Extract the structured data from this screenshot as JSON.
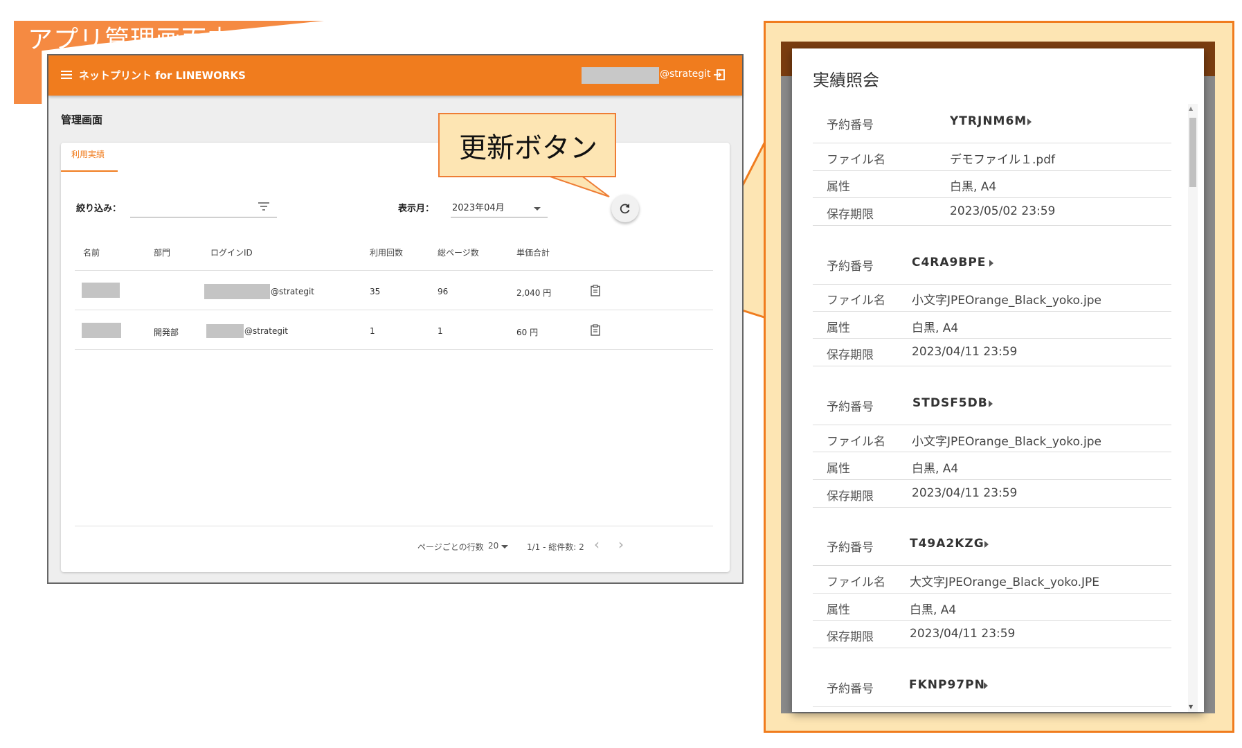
{
  "banner": {
    "title": "アプリ管理画面内"
  },
  "app": {
    "header": {
      "title": "ネットプリント for LINEWORKS",
      "user_domain": "@strategit"
    },
    "page_title": "管理画面",
    "tab": "利用実績",
    "filter": {
      "label": "絞り込み：",
      "value": ""
    },
    "month": {
      "label": "表示月：",
      "value": "2023年04月"
    },
    "columns": [
      "名前",
      "部門",
      "ログインID",
      "利用回数",
      "総ページ数",
      "単価合計"
    ],
    "rows": [
      {
        "name": "",
        "dept": "",
        "login_suffix": "@strategit",
        "uses": "35",
        "pages": "96",
        "total": "2,040 円"
      },
      {
        "name": "",
        "dept": "開発部",
        "login_suffix": "@strategit",
        "uses": "1",
        "pages": "1",
        "total": "60 円"
      }
    ],
    "pager": {
      "rows_label": "ページごとの行数",
      "rows_value": "20",
      "range": "1/1 - 総件数: 2"
    }
  },
  "callout": {
    "text": "更新ボタン"
  },
  "modal": {
    "title": "実績照会",
    "field_labels": {
      "code": "予約番号",
      "file": "ファイル名",
      "attr": "属性",
      "expiry": "保存期限"
    },
    "records": [
      {
        "code": "YTRJNM6M",
        "file": "デモファイル１.pdf",
        "attr": "白黒, A4",
        "expiry": "2023/05/02 23:59"
      },
      {
        "code": "C4RA9BPE",
        "file": "小文字JPEOrange_Black_yoko.jpe",
        "attr": "白黒, A4",
        "expiry": "2023/04/11 23:59"
      },
      {
        "code": "STDSF5DB",
        "file": "小文字JPEOrange_Black_yoko.jpe",
        "attr": "白黒, A4",
        "expiry": "2023/04/11 23:59"
      },
      {
        "code": "T49A2KZG",
        "file": "大文字JPEOrange_Black_yoko.JPE",
        "attr": "白黒, A4",
        "expiry": "2023/04/11 23:59"
      },
      {
        "code": "FKNP97PN"
      }
    ]
  },
  "colors": {
    "accent": "#f07c1e",
    "callout_bg": "#fde5b3",
    "banner": "#f58a42"
  }
}
